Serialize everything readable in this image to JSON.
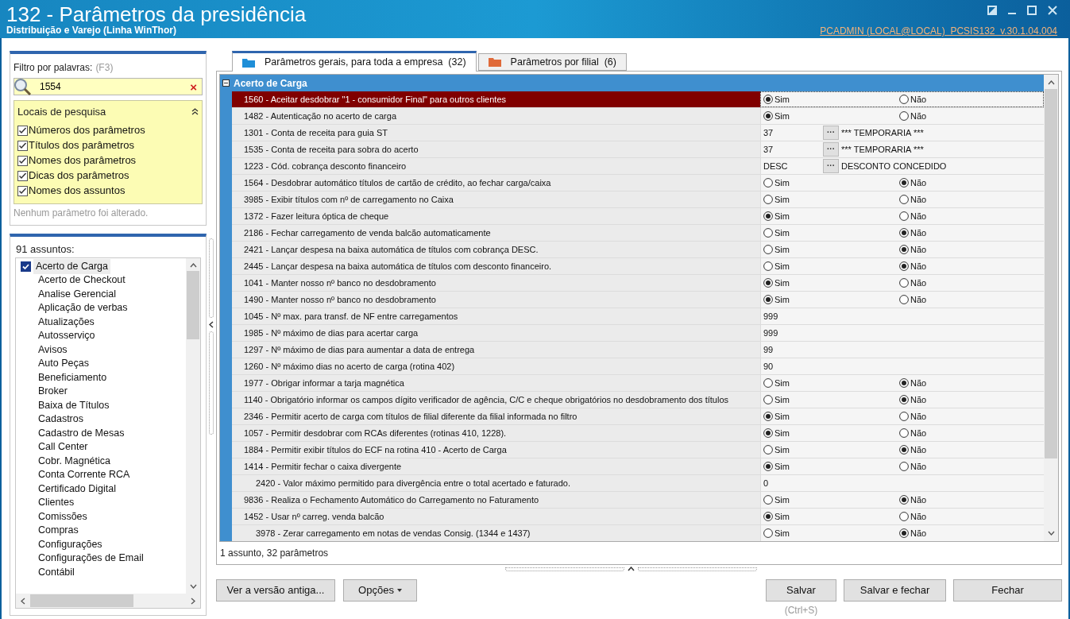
{
  "window": {
    "title": "132 - Parâmetros da presidência",
    "subtitle": "Distribuição e Varejo (Linha WinThor)",
    "session": "PCADMIN (LOCAL@LOCAL)  PCSIS132  v.30.1.04.004"
  },
  "filter": {
    "label": "Filtro por palavras:",
    "shortcut": "(F3)",
    "value": "1554",
    "clear": "×"
  },
  "search_locations": {
    "title": "Locais de pesquisa",
    "expanded": true,
    "items": [
      {
        "label": "Números dos parâmetros",
        "checked": true
      },
      {
        "label": "Títulos dos parâmetros",
        "checked": true
      },
      {
        "label": "Nomes dos parâmetros",
        "checked": true
      },
      {
        "label": "Dicas dos parâmetros",
        "checked": true
      },
      {
        "label": "Nomes dos assuntos",
        "checked": true
      }
    ]
  },
  "change_status": "Nenhum parâmetro foi alterado.",
  "subjects": {
    "label": "91 assuntos:",
    "items": [
      {
        "label": "Acerto de Carga",
        "selected": true
      },
      {
        "label": "Acerto de Checkout",
        "selected": false
      },
      {
        "label": "Analise Gerencial",
        "selected": false
      },
      {
        "label": "Aplicação de verbas",
        "selected": false
      },
      {
        "label": "Atualizações",
        "selected": false
      },
      {
        "label": "Autosserviço",
        "selected": false
      },
      {
        "label": "Avisos",
        "selected": false
      },
      {
        "label": "Auto Peças",
        "selected": false
      },
      {
        "label": "Beneficiamento",
        "selected": false
      },
      {
        "label": "Broker",
        "selected": false
      },
      {
        "label": "Baixa de Títulos",
        "selected": false
      },
      {
        "label": "Cadastros",
        "selected": false
      },
      {
        "label": "Cadastro de Mesas",
        "selected": false
      },
      {
        "label": "Call Center",
        "selected": false
      },
      {
        "label": "Cobr. Magnética",
        "selected": false
      },
      {
        "label": "Conta Corrente RCA",
        "selected": false
      },
      {
        "label": "Certificado Digital",
        "selected": false
      },
      {
        "label": "Clientes",
        "selected": false
      },
      {
        "label": "Comissões",
        "selected": false
      },
      {
        "label": "Compras",
        "selected": false
      },
      {
        "label": "Configurações",
        "selected": false
      },
      {
        "label": "Configurações de Email",
        "selected": false
      },
      {
        "label": "Contábil",
        "selected": false
      }
    ]
  },
  "tabs": [
    {
      "label": "Parâmetros gerais, para toda a empresa  (32)",
      "selected": true
    },
    {
      "label": "Parâmetros por filial  (6)",
      "selected": false
    }
  ],
  "group": {
    "title": "Acerto de Carga",
    "expanded": true
  },
  "parameters": [
    {
      "kind": "yesno",
      "label": "1560 - Aceitar desdobrar \"1 - consumidor Final\" para outros clientes",
      "selected": true,
      "options": [
        {
          "label": "Sim",
          "selected": true
        },
        {
          "label": "Não",
          "selected": false
        }
      ]
    },
    {
      "kind": "yesno",
      "label": "1482 - Autenticação no acerto de carga",
      "selected": false,
      "options": [
        {
          "label": "Sim",
          "selected": true
        },
        {
          "label": "Não",
          "selected": false
        }
      ]
    },
    {
      "kind": "lookup",
      "label": "1301 - Conta de receita para guia ST",
      "selected": false,
      "value": "37",
      "button": "···",
      "description": "*** TEMPORARIA ***"
    },
    {
      "kind": "lookup",
      "label": "1535 - Conta de receita para sobra do acerto",
      "selected": false,
      "value": "37",
      "button": "···",
      "description": "*** TEMPORARIA ***"
    },
    {
      "kind": "lookup",
      "label": "1223 - Cód. cobrança desconto financeiro",
      "selected": false,
      "value": "DESC",
      "button": "···",
      "description": "DESCONTO CONCEDIDO"
    },
    {
      "kind": "yesno",
      "label": "1564 - Desdobrar automático títulos de cartão de crédito, ao fechar carga/caixa",
      "selected": false,
      "options": [
        {
          "label": "Sim",
          "selected": false
        },
        {
          "label": "Não",
          "selected": true
        }
      ]
    },
    {
      "kind": "yesno",
      "label": "3985 - Exibir títulos com nº de carregamento no Caixa",
      "selected": false,
      "options": [
        {
          "label": "Sim",
          "selected": false
        },
        {
          "label": "Não",
          "selected": false
        }
      ]
    },
    {
      "kind": "yesno",
      "label": "1372 - Fazer leitura óptica de cheque",
      "selected": false,
      "options": [
        {
          "label": "Sim",
          "selected": true
        },
        {
          "label": "Não",
          "selected": false
        }
      ]
    },
    {
      "kind": "yesno",
      "label": "2186 - Fechar carregamento de venda balcão automaticamente",
      "selected": false,
      "options": [
        {
          "label": "Sim",
          "selected": false
        },
        {
          "label": "Não",
          "selected": true
        }
      ]
    },
    {
      "kind": "yesno",
      "label": "2421 - Lançar despesa na baixa automática de títulos com cobrança DESC.",
      "selected": false,
      "options": [
        {
          "label": "Sim",
          "selected": false
        },
        {
          "label": "Não",
          "selected": true
        }
      ]
    },
    {
      "kind": "yesno",
      "label": "2445 - Lançar despesa na baixa automática de títulos com desconto financeiro.",
      "selected": false,
      "options": [
        {
          "label": "Sim",
          "selected": false
        },
        {
          "label": "Não",
          "selected": true
        }
      ]
    },
    {
      "kind": "yesno",
      "label": "1041 - Manter nosso nº banco no desdobramento",
      "selected": false,
      "options": [
        {
          "label": "Sim",
          "selected": true
        },
        {
          "label": "Não",
          "selected": false
        }
      ]
    },
    {
      "kind": "yesno",
      "label": "1490 - Manter nosso nº banco no desdobramento",
      "selected": false,
      "options": [
        {
          "label": "Sim",
          "selected": true
        },
        {
          "label": "Não",
          "selected": false
        }
      ]
    },
    {
      "kind": "number",
      "label": "1045 - Nº max. para transf. de NF entre carregamentos",
      "selected": false,
      "value": "999"
    },
    {
      "kind": "number",
      "label": "1985 - Nº máximo de dias para acertar carga",
      "selected": false,
      "value": "999"
    },
    {
      "kind": "number",
      "label": "1297 - Nº máximo de dias para aumentar a data de entrega",
      "selected": false,
      "value": "99"
    },
    {
      "kind": "number",
      "label": "1260 - Nº máximo dias no acerto de carga (rotina 402)",
      "selected": false,
      "value": "90"
    },
    {
      "kind": "yesno",
      "label": "1977 - Obrigar informar a tarja magnética",
      "selected": false,
      "options": [
        {
          "label": "Sim",
          "selected": false
        },
        {
          "label": "Não",
          "selected": true
        }
      ]
    },
    {
      "kind": "yesno",
      "label": "1140 - Obrigatório informar os campos dígito verificador de agência, C/C e cheque obrigatórios no desdobramento dos títulos",
      "selected": false,
      "options": [
        {
          "label": "Sim",
          "selected": false
        },
        {
          "label": "Não",
          "selected": true
        }
      ]
    },
    {
      "kind": "yesno",
      "label": "2346 - Permitir acerto de carga com títulos de filial diferente da filial informada no filtro",
      "selected": false,
      "options": [
        {
          "label": "Sim",
          "selected": true
        },
        {
          "label": "Não",
          "selected": false
        }
      ]
    },
    {
      "kind": "yesno",
      "label": "1057 - Permitir desdobrar com RCAs diferentes (rotinas 410, 1228).",
      "selected": false,
      "options": [
        {
          "label": "Sim",
          "selected": true
        },
        {
          "label": "Não",
          "selected": false
        }
      ]
    },
    {
      "kind": "yesno",
      "label": "1884 - Permitir exibir títulos do ECF na rotina 410 - Acerto de Carga",
      "selected": false,
      "options": [
        {
          "label": "Sim",
          "selected": false
        },
        {
          "label": "Não",
          "selected": true
        }
      ]
    },
    {
      "kind": "yesno",
      "label": "1414 - Permitir fechar o caixa divergente",
      "selected": false,
      "options": [
        {
          "label": "Sim",
          "selected": true
        },
        {
          "label": "Não",
          "selected": false
        }
      ],
      "children": [
        {
          "kind": "number",
          "label": "2420 - Valor máximo permitido para divergência entre o total acertado e faturado.",
          "selected": false,
          "value": "0"
        }
      ]
    },
    {
      "kind": "yesno",
      "label": "9836 - Realiza o Fechamento Automático do Carregamento no Faturamento",
      "selected": false,
      "options": [
        {
          "label": "Sim",
          "selected": false
        },
        {
          "label": "Não",
          "selected": true
        }
      ]
    },
    {
      "kind": "yesno",
      "label": "1452 - Usar nº carreg. venda balcão",
      "selected": false,
      "options": [
        {
          "label": "Sim",
          "selected": true
        },
        {
          "label": "Não",
          "selected": false
        }
      ],
      "children": [
        {
          "kind": "yesno",
          "label": "3978 - Zerar carregamento em notas de vendas Consig. (1344 e 1437)",
          "selected": false,
          "options": [
            {
              "label": "Sim",
              "selected": false
            },
            {
              "label": "Não",
              "selected": true
            }
          ]
        }
      ]
    }
  ],
  "status": "1 assunto, 32 parâmetros",
  "buttons": {
    "left": [
      {
        "label": "Ver a versão antiga...",
        "kind": "plain"
      },
      {
        "label": "Opções",
        "kind": "menu"
      }
    ],
    "right": [
      {
        "label": "Salvar",
        "hint": "(Ctrl+S)"
      },
      {
        "label": "Salvar e fechar"
      },
      {
        "label": "Fechar"
      }
    ]
  }
}
